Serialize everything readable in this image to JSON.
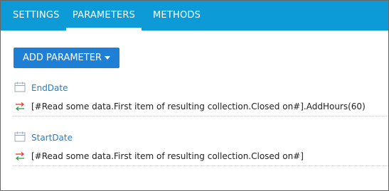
{
  "tabs": [
    {
      "label": "SETTINGS",
      "active": false
    },
    {
      "label": "PARAMETERS",
      "active": true
    },
    {
      "label": "METHODS",
      "active": false
    }
  ],
  "toolbar": {
    "add_parameter_label": "ADD PARAMETER",
    "add_parameter_icon": "caret-down-icon"
  },
  "parameters": [
    {
      "name": "EndDate",
      "type_icon": "calendar-icon",
      "value_icon": "mapping-arrows-icon",
      "value": "[#Read some data.First item of resulting collection.Closed on#].AddHours(60)"
    },
    {
      "name": "StartDate",
      "type_icon": "calendar-icon",
      "value_icon": "mapping-arrows-icon",
      "value": "[#Read some data.First item of resulting collection.Closed on#]"
    }
  ],
  "colors": {
    "tab_bar": "#0d9bd8",
    "button": "#1e7fd5",
    "link": "#1e7fd5",
    "arrow_right": "#e03c31",
    "arrow_left": "#2e9e44"
  }
}
